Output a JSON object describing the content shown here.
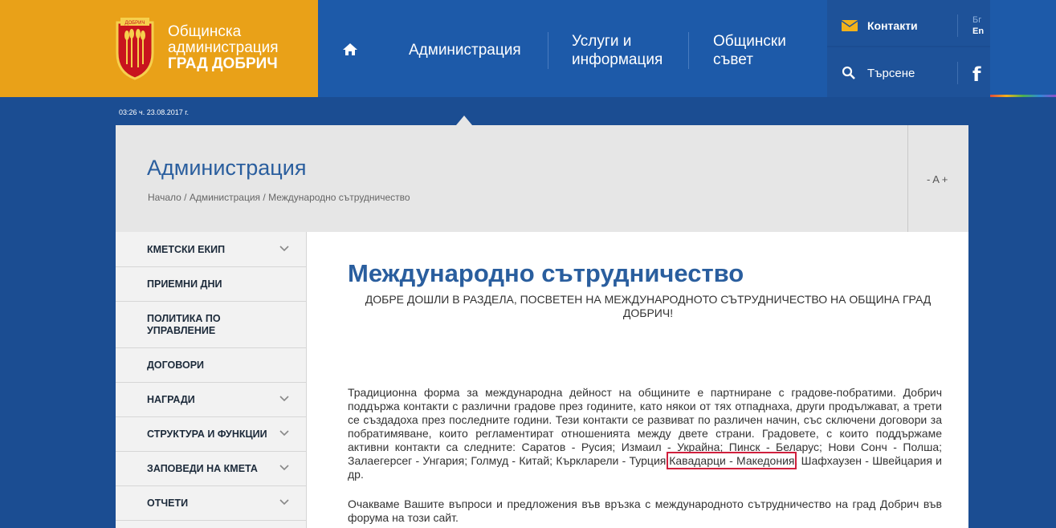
{
  "brand": {
    "line1": "Общинска",
    "line2": "администрация",
    "line3": "ГРАД ДОБРИЧ",
    "crest_text": "ДОБРИЧ",
    "color": "#e9a118"
  },
  "nav": {
    "home_icon": "home-icon",
    "items": [
      {
        "line1": "Администрация",
        "line2": ""
      },
      {
        "line1": "Услуги и",
        "line2": "информация"
      },
      {
        "line1": "Общински",
        "line2": "съвет"
      }
    ]
  },
  "tools": {
    "contacts_label": "Контакти",
    "search_label": "Търсене",
    "lang_bg": "Бг",
    "lang_en": "En",
    "facebook": "f"
  },
  "datetime": "03:26 ч. 23.08.2017 г.",
  "titleband": {
    "title": "Администрация",
    "breadcrumb": [
      "Начало",
      "Администрация",
      "Международно сътрудничество"
    ],
    "font_control": "- A +"
  },
  "sidebar": {
    "items": [
      {
        "label": "КМЕТСКИ ЕКИП",
        "has_chevron": true
      },
      {
        "label": "ПРИЕМНИ ДНИ",
        "has_chevron": false
      },
      {
        "label": "ПОЛИТИКА ПО\nУПРАВЛЕНИЕ",
        "has_chevron": false
      },
      {
        "label": "ДОГОВОРИ",
        "has_chevron": false
      },
      {
        "label": "НАГРАДИ",
        "has_chevron": true
      },
      {
        "label": "СТРУКТУРА И ФУНКЦИИ",
        "has_chevron": true
      },
      {
        "label": "ЗАПОВЕДИ НА КМЕТА",
        "has_chevron": true
      },
      {
        "label": "ОТЧЕТИ",
        "has_chevron": true
      }
    ]
  },
  "content": {
    "title": "Международно сътрудничество",
    "welcome": "ДОБРЕ ДОШЛИ В РАЗДЕЛА, ПОСВЕТЕН НА МЕЖДУНАРОДНОТО СЪТРУДНИЧЕСТВО НА ОБЩИНА ГРАД ДОБРИЧ!",
    "para1_before": "Традиционна форма за международна дейност на общините е партниране с градове-побратими. Добрич поддържа контакти с различни градове през годините, като някои от тях отпаднаха, други продължават, а трети се създадоха през последните години. Тези контакти се развиват по различен начин, със сключени договори за побратимяване, които регламентират отношенията между двете страни. Градовете, с които поддържаме активни контакти са следните: Саратов - Русия; Измаил - Украйна; Пинск - Беларус; Нови Сонч - Полша; Залаегерсег - Унгария; Голмуд - Китай; Къркларели - Турция;",
    "para1_highlight": "Кавадарци - Македония",
    "para1_after": ", Шафхаузен - Швейцария и др.",
    "para2": "Очакваме Вашите въпроси и предложения във връзка с международното сътрудничество на град Добрич във форума на този сайт."
  }
}
